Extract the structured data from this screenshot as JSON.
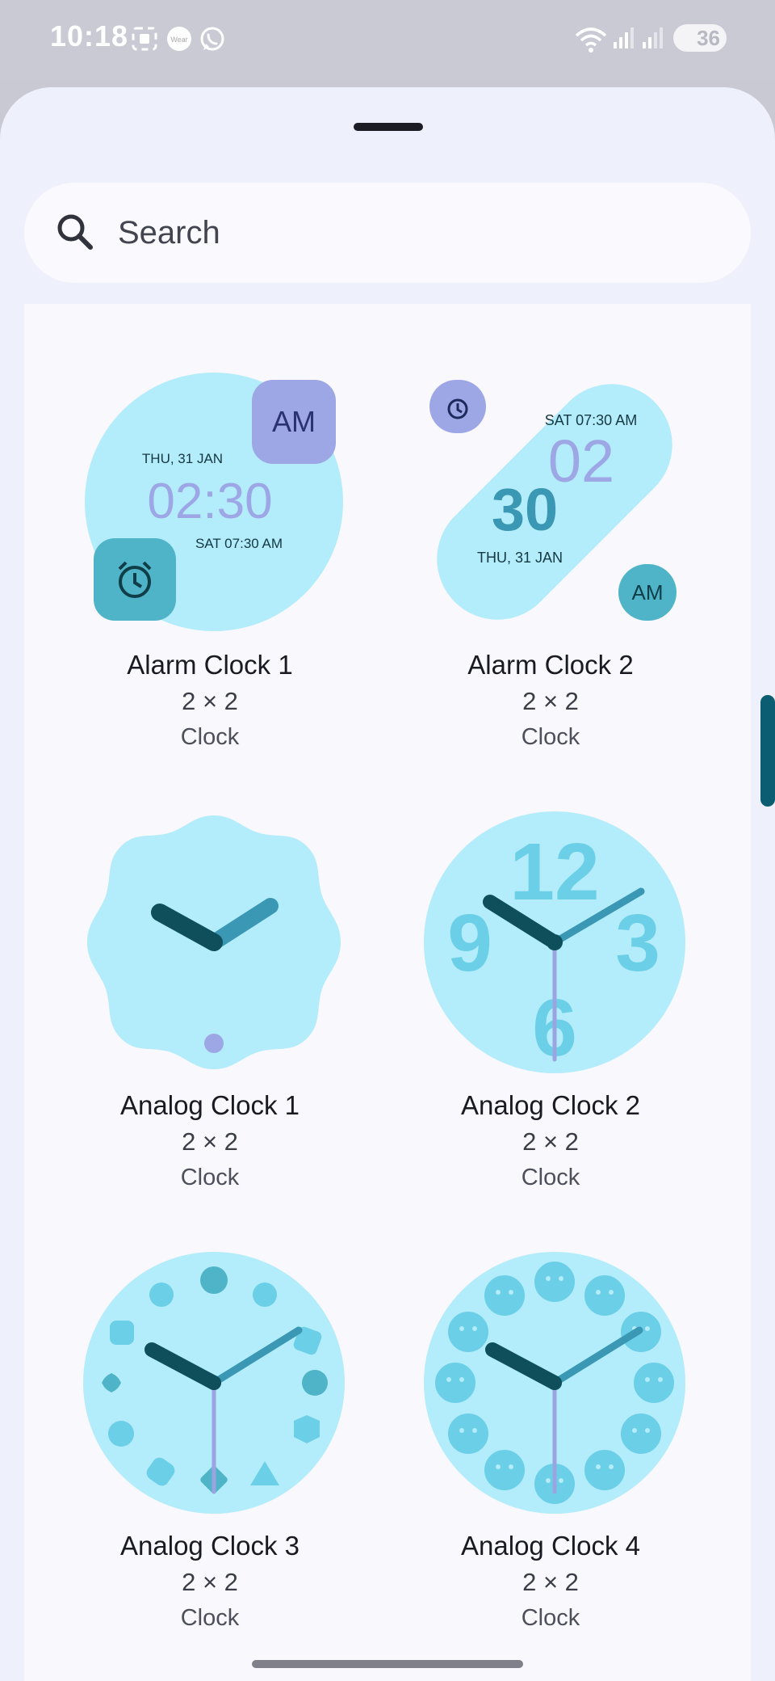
{
  "status_bar": {
    "time": "10:18",
    "battery": "36",
    "icons": [
      "screenshot-icon",
      "wear-icon",
      "whatsapp-icon",
      "wifi-icon",
      "signal-icon",
      "signal-icon",
      "battery-icon"
    ]
  },
  "search": {
    "placeholder": "Search"
  },
  "widgets": [
    {
      "name": "Alarm Clock 1",
      "size": "2 × 2",
      "category": "Clock",
      "preview": {
        "date": "THU, 31 JAN",
        "time": "02:30",
        "alarm": "SAT 07:30 AM",
        "ampm": "AM"
      }
    },
    {
      "name": "Alarm Clock 2",
      "size": "2 × 2",
      "category": "Clock",
      "preview": {
        "date": "THU, 31 JAN",
        "hour": "02",
        "minute": "30",
        "alarm": "SAT 07:30 AM",
        "ampm": "AM"
      }
    },
    {
      "name": "Analog Clock 1",
      "size": "2 × 2",
      "category": "Clock"
    },
    {
      "name": "Analog Clock 2",
      "size": "2 × 2",
      "category": "Clock",
      "preview": {
        "n12": "12",
        "n3": "3",
        "n6": "6",
        "n9": "9"
      }
    },
    {
      "name": "Analog Clock 3",
      "size": "2 × 2",
      "category": "Clock"
    },
    {
      "name": "Analog Clock 4",
      "size": "2 × 2",
      "category": "Clock"
    }
  ],
  "colors": {
    "face": "#b3ecfa",
    "hour_hand": "#0f4f5c",
    "minute_hand": "#3a98b4",
    "second_hand": "#9aa4e0",
    "accent_purple": "#9ea7e6",
    "accent_teal": "#4fb4c8"
  }
}
